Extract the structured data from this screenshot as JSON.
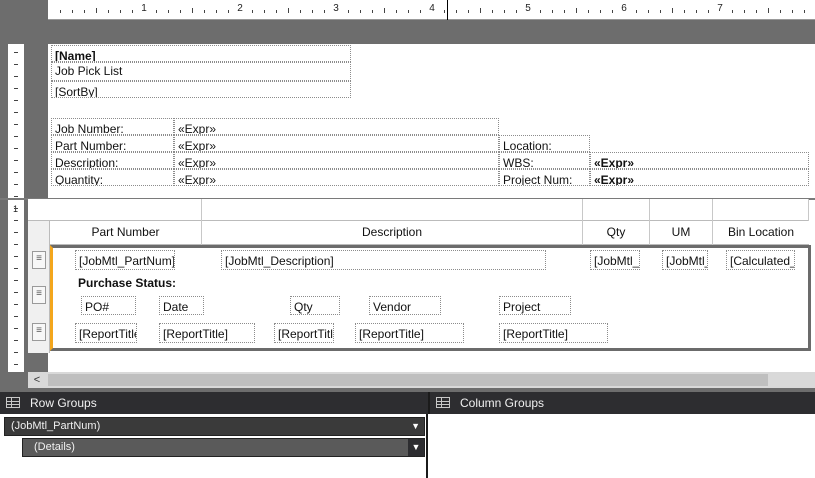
{
  "ruler": {
    "numbers": [
      "1",
      "2",
      "3",
      "4",
      "5",
      "6",
      "7"
    ],
    "vertical_numbers": [
      "1"
    ]
  },
  "header": {
    "name_field": "[Name]",
    "report_title": "Job Pick List",
    "sort_by": "[SortBy]"
  },
  "job_info": {
    "job_number_label": "Job Number:",
    "part_number_label": "Part Number:",
    "description_label": "Description:",
    "quantity_label": "Quantity:",
    "expr": "«Expr»",
    "location_label": "Location:",
    "wbs_label": "WBS:",
    "project_num_label": "Project Num:"
  },
  "tablix": {
    "columns": [
      "Part Number",
      "Description",
      "Qty",
      "UM",
      "Bin Location"
    ],
    "detail_row": [
      "[JobMtl_PartNum]",
      "[JobMtl_Description]",
      "[JobMtl_Qty]",
      "[JobMtl_IUM]",
      "[Calculated_BinNum]"
    ],
    "purchase_status_label": "Purchase Status:",
    "po_headers": [
      "PO#",
      "Date",
      "Qty",
      "Vendor",
      "Project"
    ],
    "po_values": [
      "[ReportTitle]",
      "[ReportTitle]",
      "[ReportTitle]",
      "[ReportTitle]",
      "[ReportTitle]"
    ],
    "row_handle_glyph": "≡"
  },
  "scrollbar": {
    "left_arrow": "<"
  },
  "row_groups": {
    "title": "Row Groups",
    "items": [
      "(JobMtl_PartNum)",
      "(Details)"
    ],
    "dropdown_glyph": "▼"
  },
  "column_groups": {
    "title": "Column Groups"
  }
}
